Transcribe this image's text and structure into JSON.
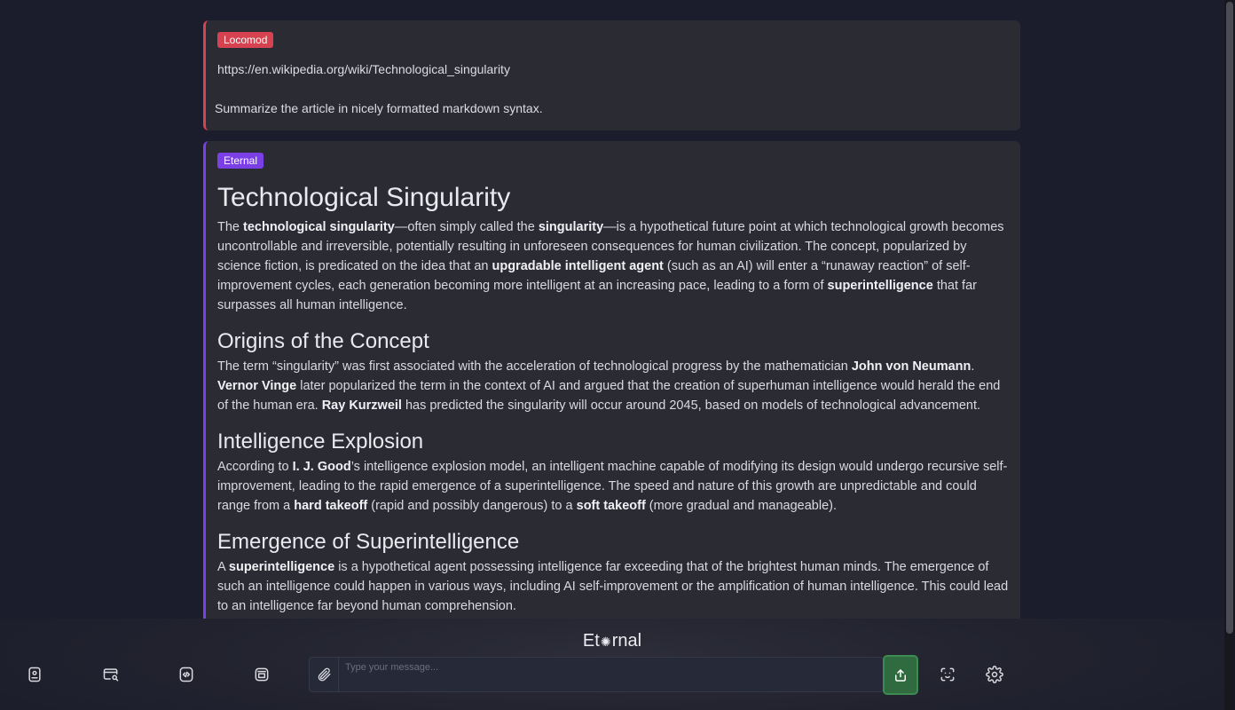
{
  "user_message": {
    "sender": "Locomod",
    "url": "https://en.wikipedia.org/wiki/Technological_singularity",
    "prompt": "Summarize the article in nicely formatted markdown syntax."
  },
  "bot_message": {
    "sender": "Eternal",
    "title": "Technological Singularity",
    "intro": {
      "t1": "The ",
      "b1": "technological singularity",
      "t2": "—often simply called the ",
      "b2": "singularity",
      "t3": "—is a hypothetical future point at which technological growth becomes uncontrollable and irreversible, potentially resulting in unforeseen consequences for human civilization. The concept, popularized by science fiction, is predicated on the idea that an ",
      "b3": "upgradable intelligent agent",
      "t4": " (such as an AI) will enter a “runaway reaction” of self-improvement cycles, each generation becoming more intelligent at an increasing pace, leading to a form of ",
      "b4": "superintelligence",
      "t5": " that far surpasses all human intelligence."
    },
    "section1": {
      "heading": "Origins of the Concept",
      "t1": "The term “singularity” was first associated with the acceleration of technological progress by the mathematician ",
      "b1": "John von Neumann",
      "t2": ". ",
      "b2": "Vernor Vinge",
      "t3": " later popularized the term in the context of AI and argued that the creation of superhuman intelligence would herald the end of the human era. ",
      "b3": "Ray Kurzweil",
      "t4": " has predicted the singularity will occur around 2045, based on models of technological advancement."
    },
    "section2": {
      "heading": "Intelligence Explosion",
      "t1": "According to ",
      "b1": "I. J. Good",
      "t2": "’s intelligence explosion model, an intelligent machine capable of modifying its design would undergo recursive self-improvement, leading to the rapid emergence of a superintelligence. The speed and nature of this growth are unpredictable and could range from a ",
      "b2": "hard takeoff",
      "t3": " (rapid and possibly dangerous) to a ",
      "b3": "soft takeoff",
      "t4": " (more gradual and manageable)."
    },
    "section3": {
      "heading": "Emergence of Superintelligence",
      "t1": "A ",
      "b1": "superintelligence",
      "t2": " is a hypothetical agent possessing intelligence far exceeding that of the brightest human minds. The emergence of such an intelligence could happen in various ways, including AI self-improvement or the amplification of human intelligence. This could lead to an intelligence far beyond human comprehension."
    }
  },
  "footer": {
    "brand_left": "Et",
    "brand_symbol": "✺",
    "brand_right": "rnal",
    "input_placeholder": "Type your message...",
    "icons": [
      "id-badge-icon",
      "card-search-icon",
      "code-file-icon",
      "printer-icon",
      "paperclip-icon",
      "share-upload-icon",
      "face-scan-icon",
      "gear-icon"
    ]
  },
  "colors": {
    "background": "#1b1c2c",
    "card": "#2b2c33",
    "user_accent": "#d6424f",
    "bot_accent": "#7b3fe6",
    "send_button": "#2f6b3f"
  }
}
